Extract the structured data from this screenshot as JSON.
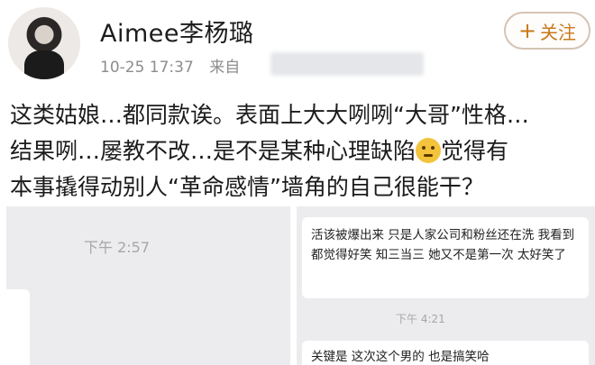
{
  "user": {
    "name": "Aimee李杨璐",
    "time": "10-25 17:37",
    "source_prefix": "来自"
  },
  "follow_button": {
    "label": "关注",
    "icon": "plus-icon"
  },
  "post": {
    "line1": "这类姑娘…都同款诶。表面上大大咧咧“大哥”性格…",
    "line2_a": "结果咧…屡教不改…是不是某种心理缺陷",
    "line2_emoji": "thinking-face-icon",
    "line2_b": "觉得有",
    "line3": "本事撬得动别人“革命感情”墙角的自己很能干？"
  },
  "images": [
    {
      "time": "下午 2:57"
    },
    {
      "message1": "活该被爆出来 只是人家公司和粉丝还在洗 我看到都觉得好笑 知三当三 她又不是第一次 太好笑了",
      "time": "下午 4:21",
      "message2": "关键是 这次这个男的 也是搞笑哈"
    }
  ]
}
